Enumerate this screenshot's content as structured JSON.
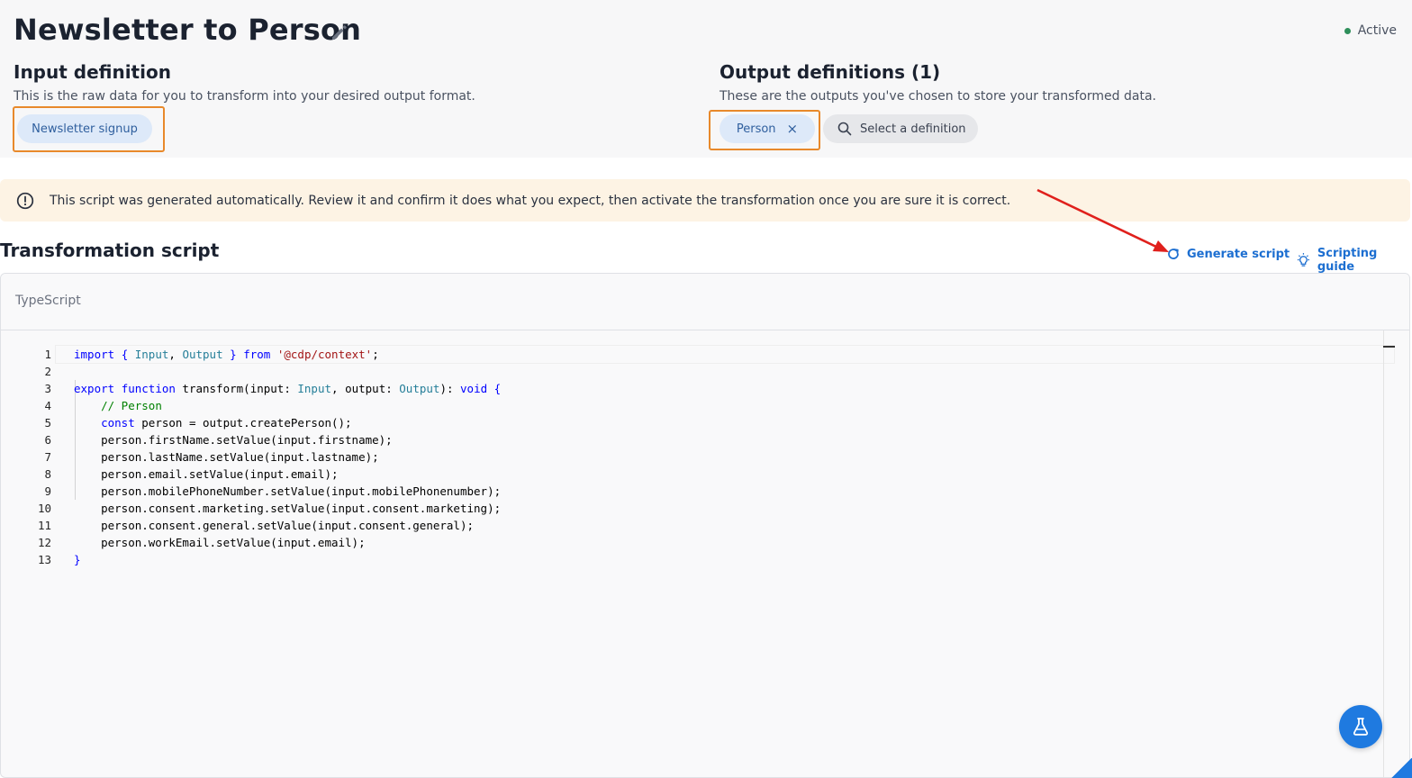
{
  "header": {
    "title": "Newsletter to Person",
    "status": "Active"
  },
  "input": {
    "heading": "Input definition",
    "description": "This is the raw data for you to transform into your desired output format.",
    "chip": "Newsletter signup"
  },
  "output": {
    "heading": "Output definitions (1)",
    "description": "These are the outputs you've chosen to store your transformed data.",
    "chip": "Person",
    "chip_remove": "×",
    "select_placeholder": "Select a definition"
  },
  "alert": {
    "message": "This script was generated automatically. Review it and confirm it does what you expect, then activate the transformation once you are sure it is correct."
  },
  "script": {
    "heading": "Transformation script",
    "generate_label": "Generate script",
    "guide_label": "Scripting guide",
    "language": "TypeScript",
    "line_numbers": [
      "1",
      "2",
      "3",
      "4",
      "5",
      "6",
      "7",
      "8",
      "9",
      "10",
      "11",
      "12",
      "13"
    ],
    "lines": [
      [
        [
          "kw",
          "import"
        ],
        [
          "plain",
          " "
        ],
        [
          "kw",
          "{"
        ],
        [
          "plain",
          " "
        ],
        [
          "type",
          "Input"
        ],
        [
          "plain",
          ", "
        ],
        [
          "type",
          "Output"
        ],
        [
          "plain",
          " "
        ],
        [
          "kw",
          "}"
        ],
        [
          "plain",
          " "
        ],
        [
          "kw",
          "from"
        ],
        [
          "plain",
          " "
        ],
        [
          "str",
          "'@cdp/context'"
        ],
        [
          "plain",
          ";"
        ]
      ],
      [],
      [
        [
          "kw",
          "export"
        ],
        [
          "plain",
          " "
        ],
        [
          "kw",
          "function"
        ],
        [
          "plain",
          " transform(input: "
        ],
        [
          "type",
          "Input"
        ],
        [
          "plain",
          ", output: "
        ],
        [
          "type",
          "Output"
        ],
        [
          "plain",
          "): "
        ],
        [
          "kw",
          "void"
        ],
        [
          "plain",
          " "
        ],
        [
          "kw",
          "{"
        ]
      ],
      [
        [
          "plain",
          "    "
        ],
        [
          "com",
          "// Person"
        ]
      ],
      [
        [
          "plain",
          "    "
        ],
        [
          "kw",
          "const"
        ],
        [
          "plain",
          " person = output.createPerson();"
        ]
      ],
      [
        [
          "plain",
          "    person.firstName.setValue(input.firstname);"
        ]
      ],
      [
        [
          "plain",
          "    person.lastName.setValue(input.lastname);"
        ]
      ],
      [
        [
          "plain",
          "    person.email.setValue(input.email);"
        ]
      ],
      [
        [
          "plain",
          "    person.mobilePhoneNumber.setValue(input.mobilePhonenumber);"
        ]
      ],
      [
        [
          "plain",
          "    person.consent.marketing.setValue(input.consent.marketing);"
        ]
      ],
      [
        [
          "plain",
          "    person.consent.general.setValue(input.consent.general);"
        ]
      ],
      [
        [
          "plain",
          "    person.workEmail.setValue(input.email);"
        ]
      ],
      [
        [
          "kw",
          "}"
        ]
      ]
    ]
  },
  "colors": {
    "accent": "#1d6fd1",
    "highlight_frame": "#e8892b",
    "alert_bg": "#fdf3e4",
    "status_dot": "#2f8f5b",
    "annotation_arrow": "#e0201c"
  },
  "icons": {
    "edit": "pencil-icon",
    "status": "dot-icon",
    "remove": "close-icon",
    "search": "search-icon",
    "alert": "exclamation-circle-icon",
    "generate": "refresh-icon",
    "guide": "lightbulb-icon",
    "test": "flask-icon"
  }
}
